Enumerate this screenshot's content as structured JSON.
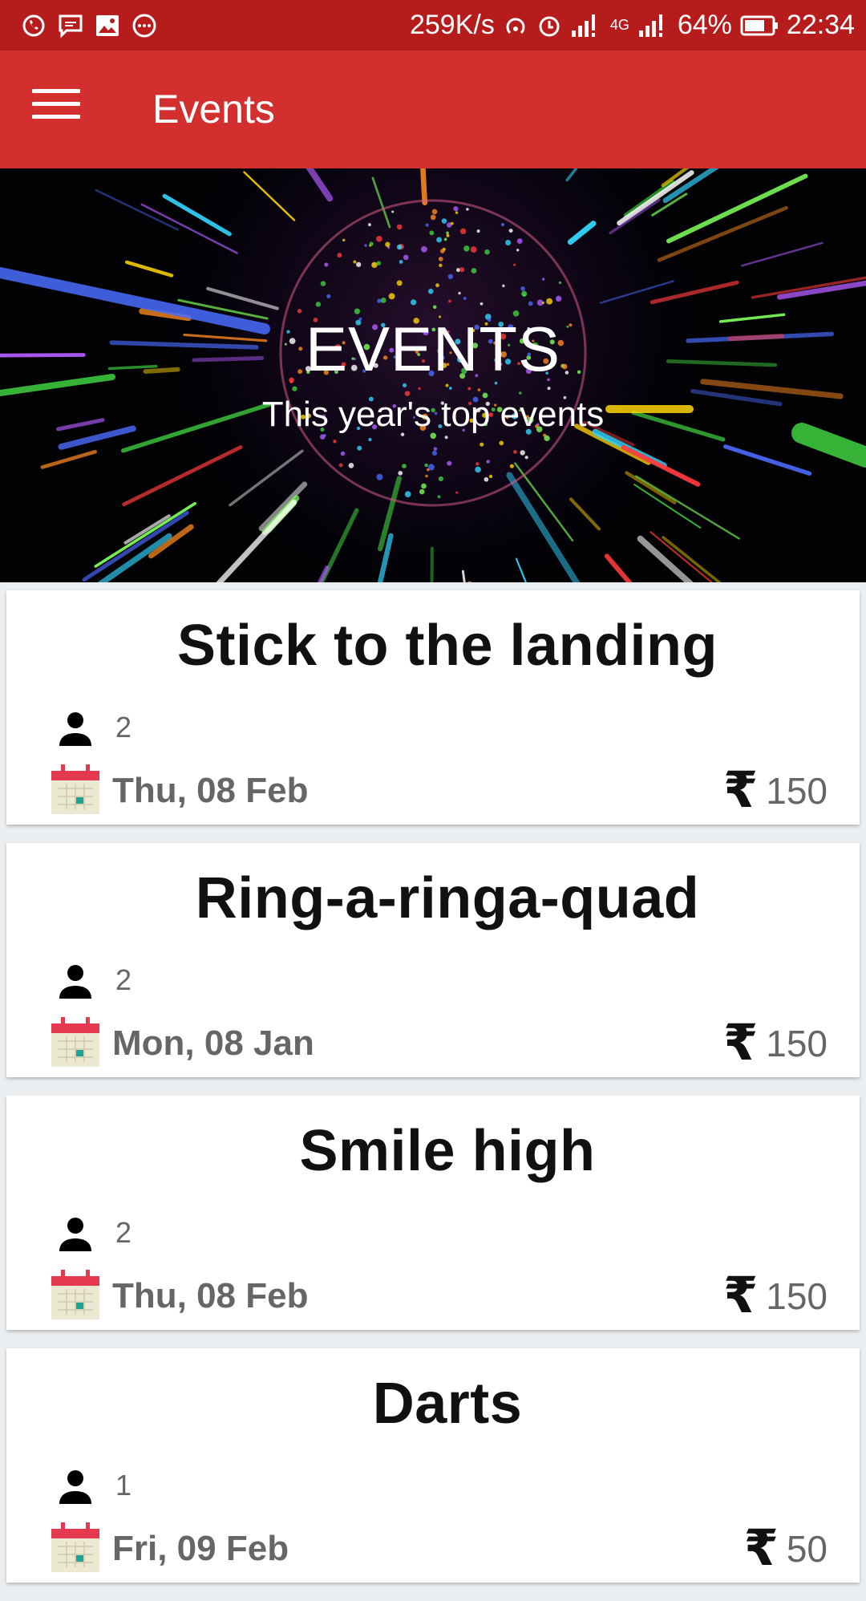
{
  "status_bar": {
    "speed": "259K/s",
    "network": "4G",
    "battery": "64%",
    "time": "22:34",
    "icons": [
      "whatsapp-icon",
      "message-icon",
      "image-icon",
      "more-icon",
      "hotspot-icon",
      "alarm-icon",
      "signal-icon",
      "battery-icon"
    ]
  },
  "app_bar": {
    "title": "Events",
    "menu_icon": "menu-icon"
  },
  "hero": {
    "title": "EVENTS",
    "subtitle": "This year's top events"
  },
  "currency_symbol": "₹",
  "events": [
    {
      "title": "Stick to the landing",
      "count": "2",
      "date": "Thu, 08 Feb",
      "price": "150"
    },
    {
      "title": "Ring-a-ringa-quad",
      "count": "2",
      "date": "Mon, 08 Jan",
      "price": "150"
    },
    {
      "title": "Smile high",
      "count": "2",
      "date": "Thu, 08 Feb",
      "price": "150"
    },
    {
      "title": "Darts",
      "count": "1",
      "date": "Fri, 09 Feb",
      "price": "50"
    }
  ],
  "colors": {
    "status_bar": "#b71c1c",
    "app_bar": "#d32f2f",
    "background": "#eceff1"
  }
}
